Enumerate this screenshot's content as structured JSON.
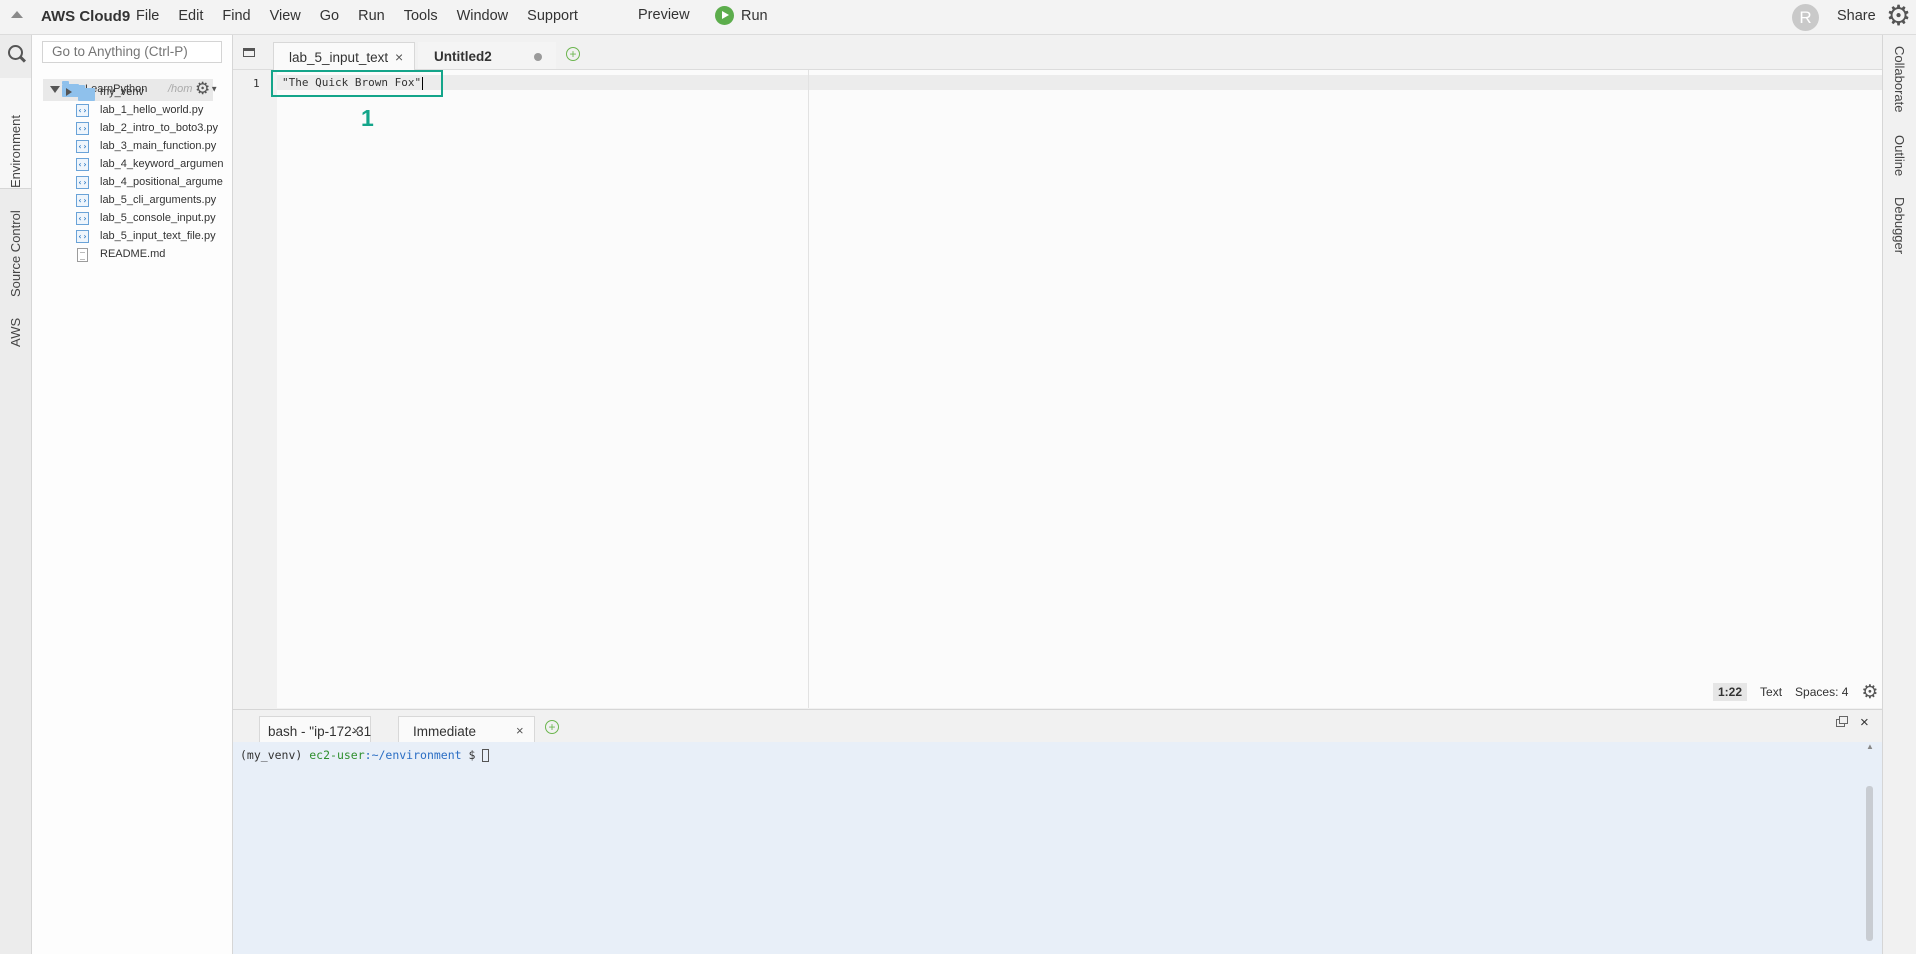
{
  "menubar": {
    "brand": "AWS Cloud9",
    "menus": [
      "File",
      "Edit",
      "Find",
      "View",
      "Go",
      "Run",
      "Tools",
      "Window",
      "Support"
    ],
    "preview": "Preview",
    "run": "Run",
    "avatar_initial": "R",
    "share": "Share",
    "run_color": "#5cad4c"
  },
  "leftbar": {
    "tabs": [
      "Environment",
      "Source Control",
      "AWS"
    ]
  },
  "tree": {
    "goto_placeholder": "Go to Anything (Ctrl-P)",
    "root_name": "LearnPython",
    "root_path": "/hom",
    "items": [
      {
        "label": "my_venv",
        "type": "folder"
      },
      {
        "label": "lab_1_hello_world.py",
        "type": "py"
      },
      {
        "label": "lab_2_intro_to_boto3.py",
        "type": "py"
      },
      {
        "label": "lab_3_main_function.py",
        "type": "py"
      },
      {
        "label": "lab_4_keyword_argumen",
        "type": "py"
      },
      {
        "label": "lab_4_positional_argume",
        "type": "py"
      },
      {
        "label": "lab_5_cli_arguments.py",
        "type": "py"
      },
      {
        "label": "lab_5_console_input.py",
        "type": "py"
      },
      {
        "label": "lab_5_input_text_file.py",
        "type": "py"
      },
      {
        "label": "README.md",
        "type": "md"
      }
    ]
  },
  "editor": {
    "tabs": [
      {
        "label": "lab_5_input_text",
        "close": "×"
      },
      {
        "label": "Untitled2"
      }
    ],
    "line_number": "1",
    "code_line": "\"The Quick Brown Fox\"",
    "annotation": "1",
    "highlight_color": "#14a58a",
    "status": {
      "position": "1:22",
      "mode": "Text",
      "spaces": "Spaces: 4"
    }
  },
  "terminal": {
    "tabs": [
      {
        "label": "bash - \"ip-172-31",
        "close": "×"
      },
      {
        "label": "Immediate",
        "close": "×"
      }
    ],
    "close": "×",
    "prompt_env": "(my_venv) ",
    "prompt_user": "ec2-user",
    "prompt_path": ":~/environment",
    "prompt_symbol": " $ "
  },
  "rightbar": {
    "tabs": [
      "Collaborate",
      "Outline",
      "Debugger"
    ]
  }
}
